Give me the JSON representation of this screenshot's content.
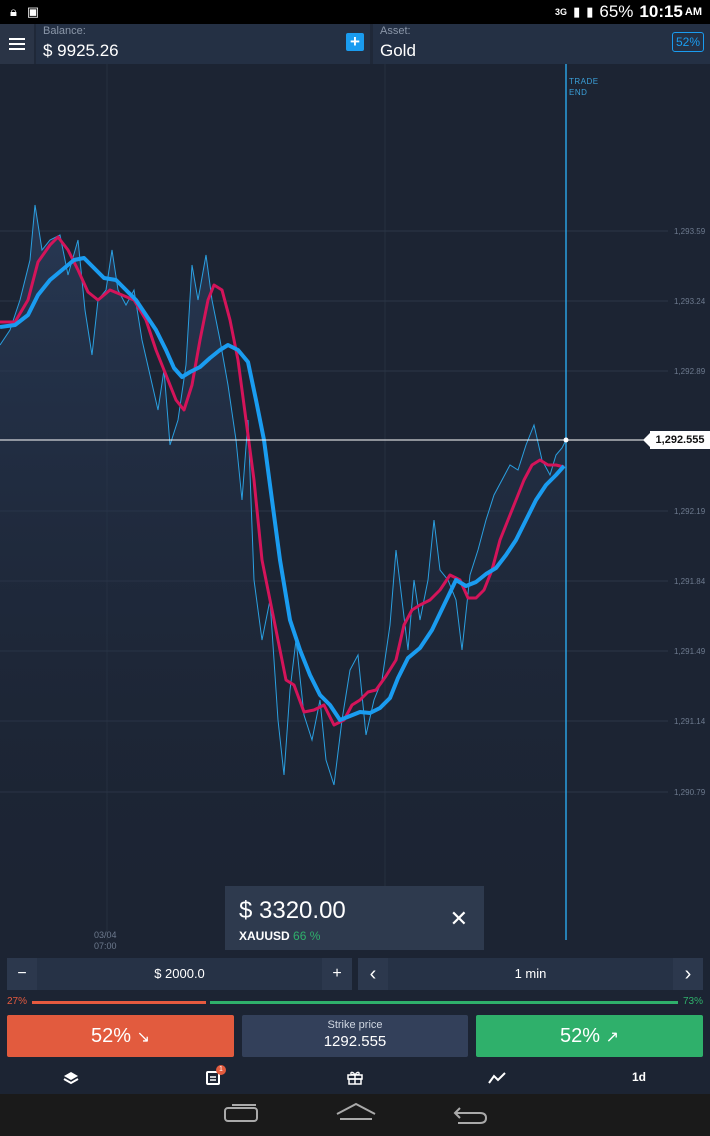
{
  "status_bar": {
    "network": "3G",
    "battery": "65%",
    "time": "10:15",
    "ampm": "AM"
  },
  "header": {
    "balance_label": "Balance:",
    "balance_value": "$ 9925.26",
    "asset_label": "Asset:",
    "asset_value": "Gold",
    "payout_badge": "52%"
  },
  "chart": {
    "trade_end_label_1": "TRADE",
    "trade_end_label_2": "END",
    "price_axis": [
      "1,293.59",
      "1,293.24",
      "1,292.89",
      "1,292.19",
      "1,291.84",
      "1,291.49",
      "1,291.14",
      "1,290.79"
    ],
    "current_price": "1,292.555",
    "date_line_1": "03/04",
    "date_line_2": "07:00"
  },
  "toast": {
    "amount": "$ 3320.00",
    "asset": "XAUUSD",
    "percent": "66 %"
  },
  "controls": {
    "minus": "−",
    "amount": "$ 2000.0",
    "plus": "+",
    "prev": "‹",
    "duration": "1 min",
    "next": "›"
  },
  "sentiment": {
    "down": "27%",
    "up": "73%",
    "down_fraction": 0.27,
    "up_fraction": 0.73
  },
  "trade_buttons": {
    "put_label": "52%",
    "put_arrow": "↘",
    "strike_label": "Strike price",
    "strike_value": "1292.555",
    "call_label": "52%",
    "call_arrow": "↗"
  },
  "tabbar": {
    "timeframe": "1d",
    "notification_count": "1"
  },
  "colors": {
    "background": "#1c2433",
    "put": "#e25b3e",
    "call": "#2fb06b",
    "accent": "#1a9cf0",
    "ma_fast": "#d4145a",
    "ma_slow": "#1a9cf0"
  }
}
